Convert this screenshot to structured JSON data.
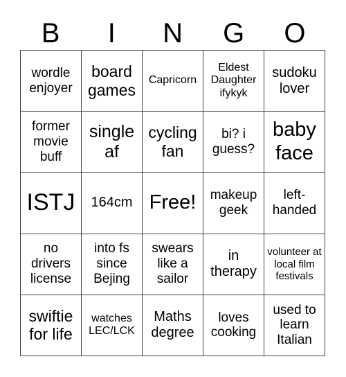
{
  "title_letters": [
    "B",
    "I",
    "N",
    "G",
    "O"
  ],
  "cells": [
    {
      "text": "wordle enjoyer",
      "size": "s19"
    },
    {
      "text": "board games",
      "size": "s23"
    },
    {
      "text": "Capricorn",
      "size": "s16"
    },
    {
      "text": "Eldest Daughter ifykyk",
      "size": "s16"
    },
    {
      "text": "sudoku lover",
      "size": "s20"
    },
    {
      "text": "former movie buff",
      "size": "s19"
    },
    {
      "text": "single af",
      "size": "s25"
    },
    {
      "text": "cycling fan",
      "size": "s23"
    },
    {
      "text": "bi? i guess?",
      "size": "s19"
    },
    {
      "text": "baby face",
      "size": "s29"
    },
    {
      "text": "ISTJ",
      "size": "s34"
    },
    {
      "text": "164cm",
      "size": "s20"
    },
    {
      "text": "Free!",
      "size": "s29"
    },
    {
      "text": "makeup geek",
      "size": "s19"
    },
    {
      "text": "left-handed",
      "size": "s19"
    },
    {
      "text": "no drivers license",
      "size": "s19"
    },
    {
      "text": "into fs since Bejing",
      "size": "s19"
    },
    {
      "text": "swears like a sailor",
      "size": "s19"
    },
    {
      "text": "in therapy",
      "size": "s20"
    },
    {
      "text": "volunteer at local film festivals",
      "size": "s14"
    },
    {
      "text": "swiftie for life",
      "size": "s23"
    },
    {
      "text": "watches LEC/LCK",
      "size": "s16"
    },
    {
      "text": "Maths degree",
      "size": "s20"
    },
    {
      "text": "loves cooking",
      "size": "s19"
    },
    {
      "text": "used to learn Italian",
      "size": "s19"
    }
  ]
}
